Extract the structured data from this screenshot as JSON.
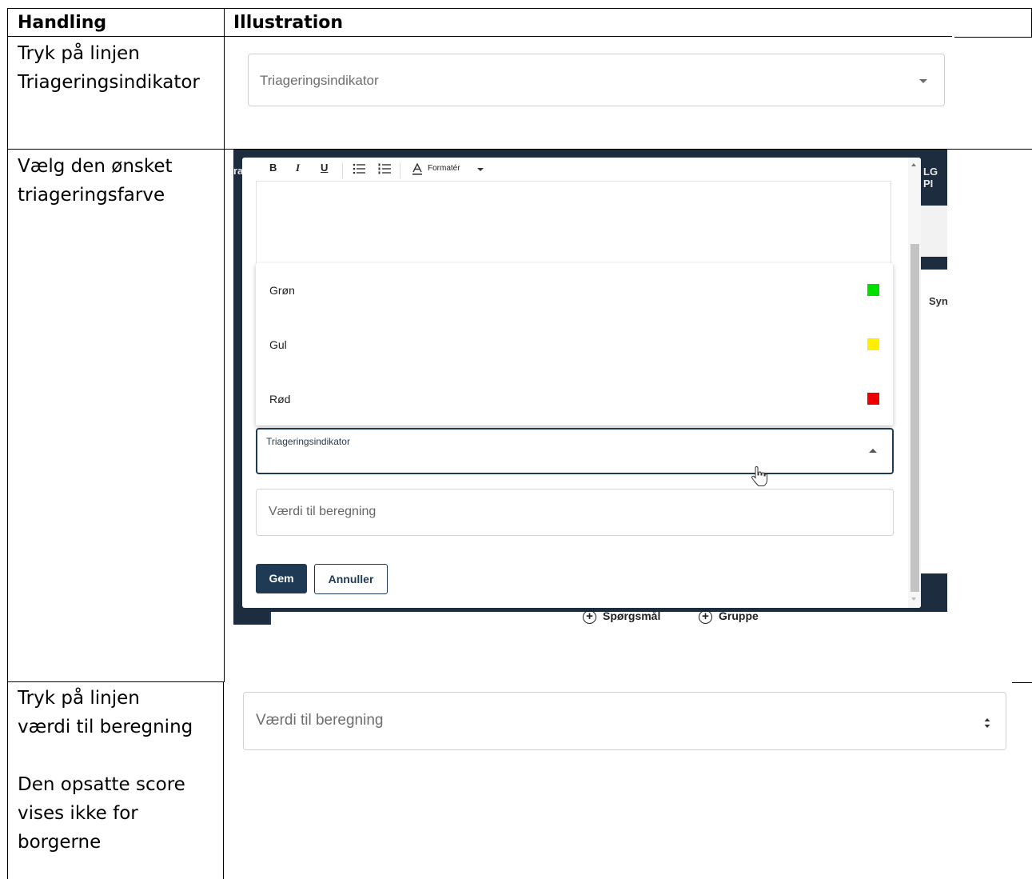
{
  "table": {
    "header_action": "Handling",
    "header_illustration": "Illustration"
  },
  "rows": [
    {
      "action_lines": [
        "Tryk på linjen",
        "Triageringsindikator"
      ],
      "illustration": {
        "select_placeholder": "Triageringsindikator"
      }
    },
    {
      "action_lines": [
        "Vælg den ønsket",
        "triageringsfarve"
      ],
      "illustration": {
        "toolbar": {
          "bold": "B",
          "italic": "I",
          "underline": "U",
          "format_label": "Formatér"
        },
        "edge_left_text": "ra",
        "edge_right_text": "LG PI",
        "edge_right_text2": "Syn",
        "options": [
          {
            "label": "Grøn",
            "color": "#00e000"
          },
          {
            "label": "Gul",
            "color": "#ffee00"
          },
          {
            "label": "Rød",
            "color": "#ee0000"
          }
        ],
        "active_field_label": "Triageringsindikator",
        "value_field_placeholder": "Værdi til beregning",
        "save_button": "Gem",
        "cancel_button": "Annuller",
        "add_question": "Spørgsmål",
        "add_group": "Gruppe"
      }
    },
    {
      "action_lines": [
        "Tryk på linjen",
        "værdi til beregning",
        "",
        "Den opsatte score",
        "vises ikke for",
        "borgerne"
      ],
      "illustration": {
        "number_placeholder": "Værdi til beregning"
      }
    }
  ],
  "colors": {
    "primary": "#1f3a55",
    "dark_background": "#1e2c3f"
  }
}
